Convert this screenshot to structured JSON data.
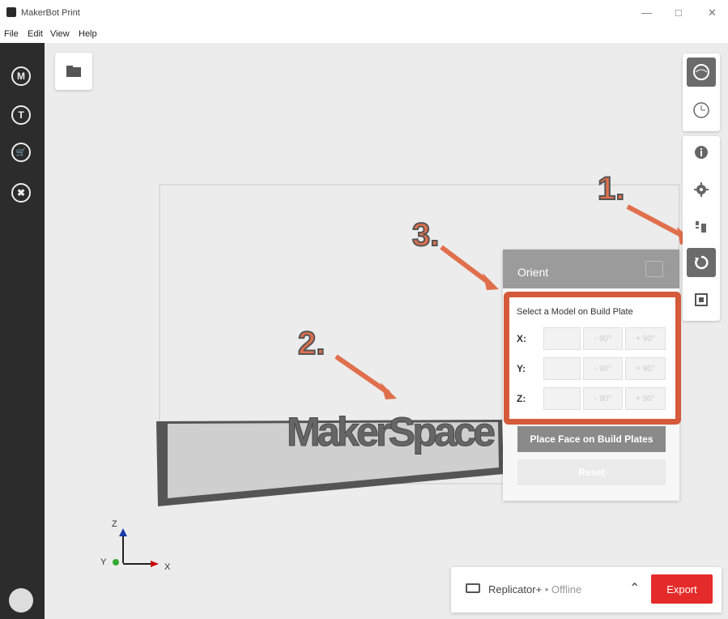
{
  "window": {
    "title": "MakerBot Print",
    "min": "—",
    "max": "□",
    "close": "✕"
  },
  "menu": [
    "File",
    "Edit",
    "View",
    "Help"
  ],
  "sidebar": {
    "icons": [
      "M",
      "T",
      "🛒",
      "✖"
    ]
  },
  "orient": {
    "title": "Orient",
    "select_text": "Select a Model on Build Plate",
    "rows": [
      {
        "label": "X:",
        "minus": "- 90°",
        "plus": "+ 90°"
      },
      {
        "label": "Y:",
        "minus": "- 90°",
        "plus": "+ 90°"
      },
      {
        "label": "Z:",
        "minus": "- 90°",
        "plus": "+ 90°"
      }
    ],
    "place_face": "Place Face on Build Plates",
    "reset": "Reset"
  },
  "annotations": [
    "1.",
    "2.",
    "3."
  ],
  "model_text": "MakerSpace",
  "axes": {
    "z": "Z",
    "y": "Y",
    "x": "X"
  },
  "bottom": {
    "printer": "Replicator+",
    "status": "• Offline",
    "export": "Export"
  }
}
